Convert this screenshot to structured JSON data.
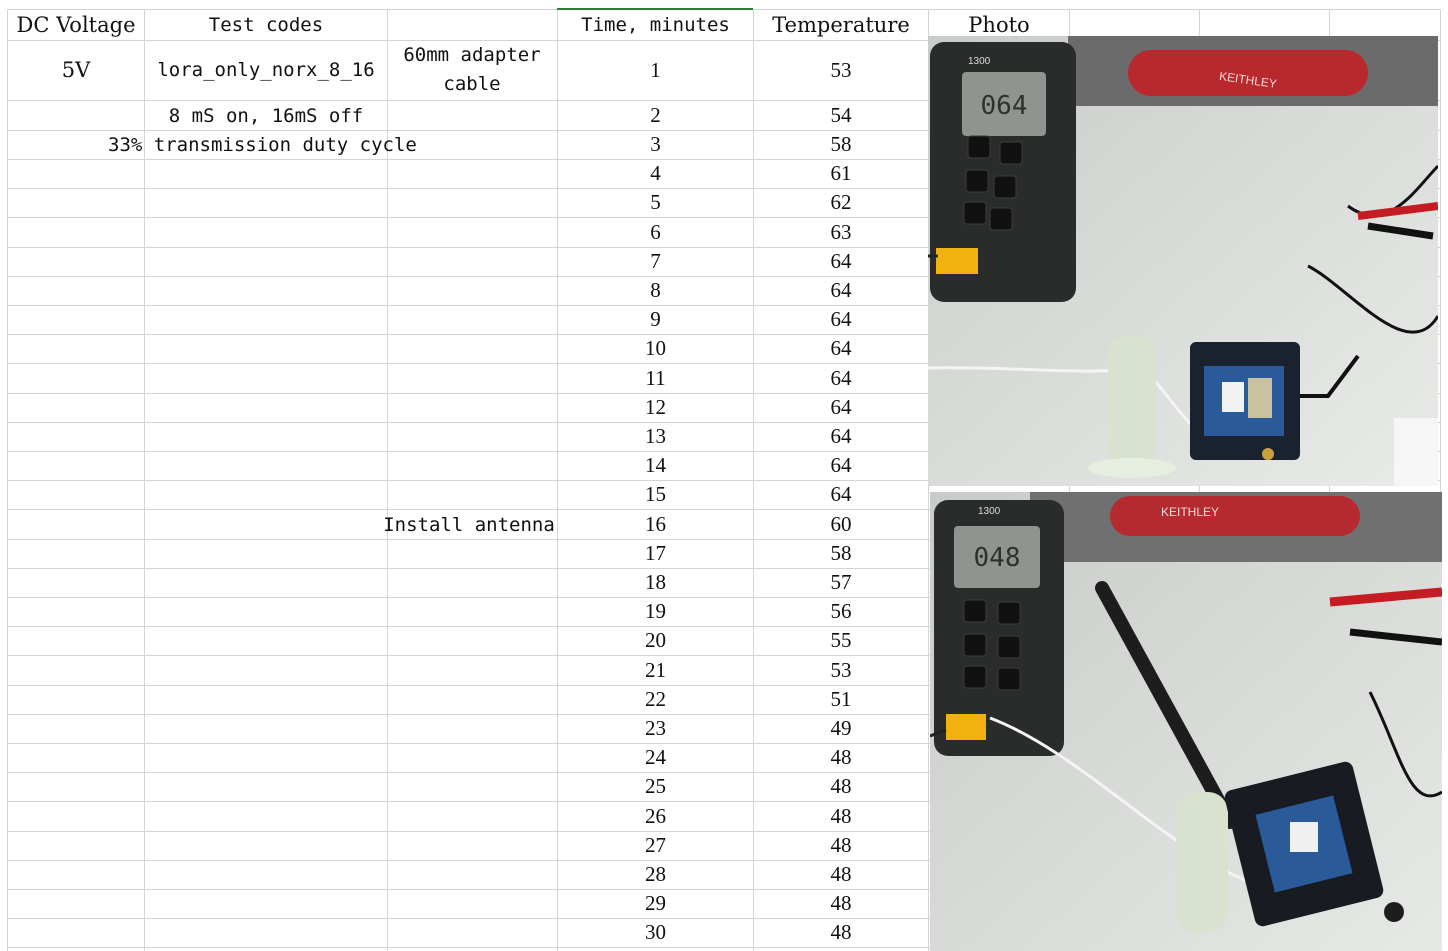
{
  "headers": {
    "dc_voltage": "DC Voltage",
    "test_codes": "Test codes",
    "time": "Time, minutes",
    "temperature": "Temperature",
    "photo": "Photo"
  },
  "setup": {
    "voltage": "5V",
    "code": "lora_only_norx_8_16",
    "cable": "60mm adapter cable",
    "timing": "8 mS on, 16mS off",
    "duty": "33% transmission duty cycle",
    "antenna_note": "Install antenna"
  },
  "rows": [
    {
      "time": "1",
      "temp": "53"
    },
    {
      "time": "2",
      "temp": "54"
    },
    {
      "time": "3",
      "temp": "58"
    },
    {
      "time": "4",
      "temp": "61"
    },
    {
      "time": "5",
      "temp": "62"
    },
    {
      "time": "6",
      "temp": "63"
    },
    {
      "time": "7",
      "temp": "64"
    },
    {
      "time": "8",
      "temp": "64"
    },
    {
      "time": "9",
      "temp": "64"
    },
    {
      "time": "10",
      "temp": "64"
    },
    {
      "time": "11",
      "temp": "64"
    },
    {
      "time": "12",
      "temp": "64"
    },
    {
      "time": "13",
      "temp": "64"
    },
    {
      "time": "14",
      "temp": "64"
    },
    {
      "time": "15",
      "temp": "64"
    },
    {
      "time": "16",
      "temp": "60"
    },
    {
      "time": "17",
      "temp": "58"
    },
    {
      "time": "18",
      "temp": "57"
    },
    {
      "time": "19",
      "temp": "56"
    },
    {
      "time": "20",
      "temp": "55"
    },
    {
      "time": "21",
      "temp": "53"
    },
    {
      "time": "22",
      "temp": "51"
    },
    {
      "time": "23",
      "temp": "49"
    },
    {
      "time": "24",
      "temp": "48"
    },
    {
      "time": "25",
      "temp": "48"
    },
    {
      "time": "26",
      "temp": "48"
    },
    {
      "time": "27",
      "temp": "48"
    },
    {
      "time": "28",
      "temp": "48"
    },
    {
      "time": "29",
      "temp": "48"
    },
    {
      "time": "30",
      "temp": "48"
    }
  ],
  "photos": {
    "top": {
      "meter_reading": "064",
      "brand": "KEITHLEY",
      "model": "1300"
    },
    "bottom": {
      "meter_reading": "048",
      "brand": "KEITHLEY",
      "model": "1300"
    }
  }
}
